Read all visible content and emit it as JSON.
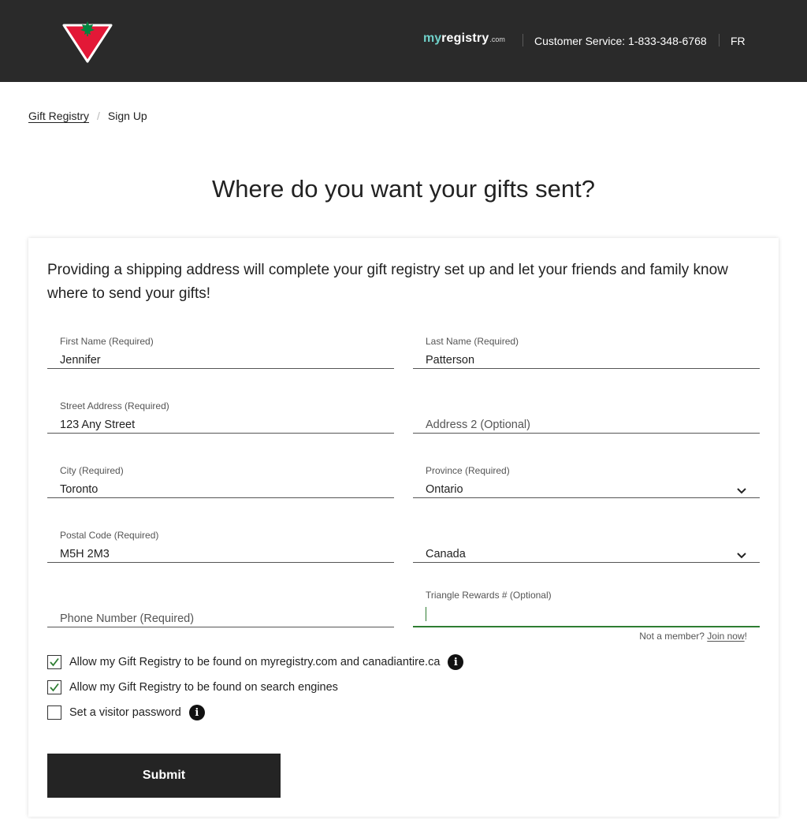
{
  "header": {
    "brand_my": "my",
    "brand_registry": "registry",
    "brand_com": ".com",
    "customer_service": "Customer Service: 1-833-348-6768",
    "language": "FR",
    "bg_color": "#2a2a2a",
    "logo_color": "#e31837",
    "leaf_color": "#00853f"
  },
  "breadcrumb": {
    "link": "Gift Registry",
    "separator": "/",
    "current": "Sign Up"
  },
  "page_title": "Where do you want your gifts sent?",
  "intro": "Providing a shipping address will complete your gift registry set up and let your friends and family know where to send your gifts!",
  "form": {
    "first_name": {
      "label": "First Name (Required)",
      "value": "Jennifer"
    },
    "last_name": {
      "label": "Last Name (Required)",
      "value": "Patterson"
    },
    "street": {
      "label": "Street Address (Required)",
      "value": "123 Any Street"
    },
    "address2": {
      "placeholder": "Address 2 (Optional)"
    },
    "city": {
      "label": "City (Required)",
      "value": "Toronto"
    },
    "province": {
      "label": "Province (Required)",
      "value": "Ontario"
    },
    "postal": {
      "label": "Postal Code (Required)",
      "value": "M5H 2M3"
    },
    "country": {
      "value": "Canada"
    },
    "phone": {
      "placeholder": "Phone Number (Required)"
    },
    "rewards": {
      "label": "Triangle Rewards # (Optional)",
      "value": ""
    },
    "member_note_prefix": "Not a member?",
    "join_link": "Join now",
    "member_note_suffix": "!",
    "checkboxes": [
      {
        "label": "Allow my Gift Registry to be found on myregistry.com and canadiantire.ca",
        "checked": true
      },
      {
        "label": "Allow my Gift Registry to be found on search engines",
        "checked": true
      },
      {
        "label": "Set a visitor password",
        "checked": false
      }
    ],
    "info_glyph": "i",
    "submit_label": "Submit",
    "focus_color": "#2e7d32"
  }
}
